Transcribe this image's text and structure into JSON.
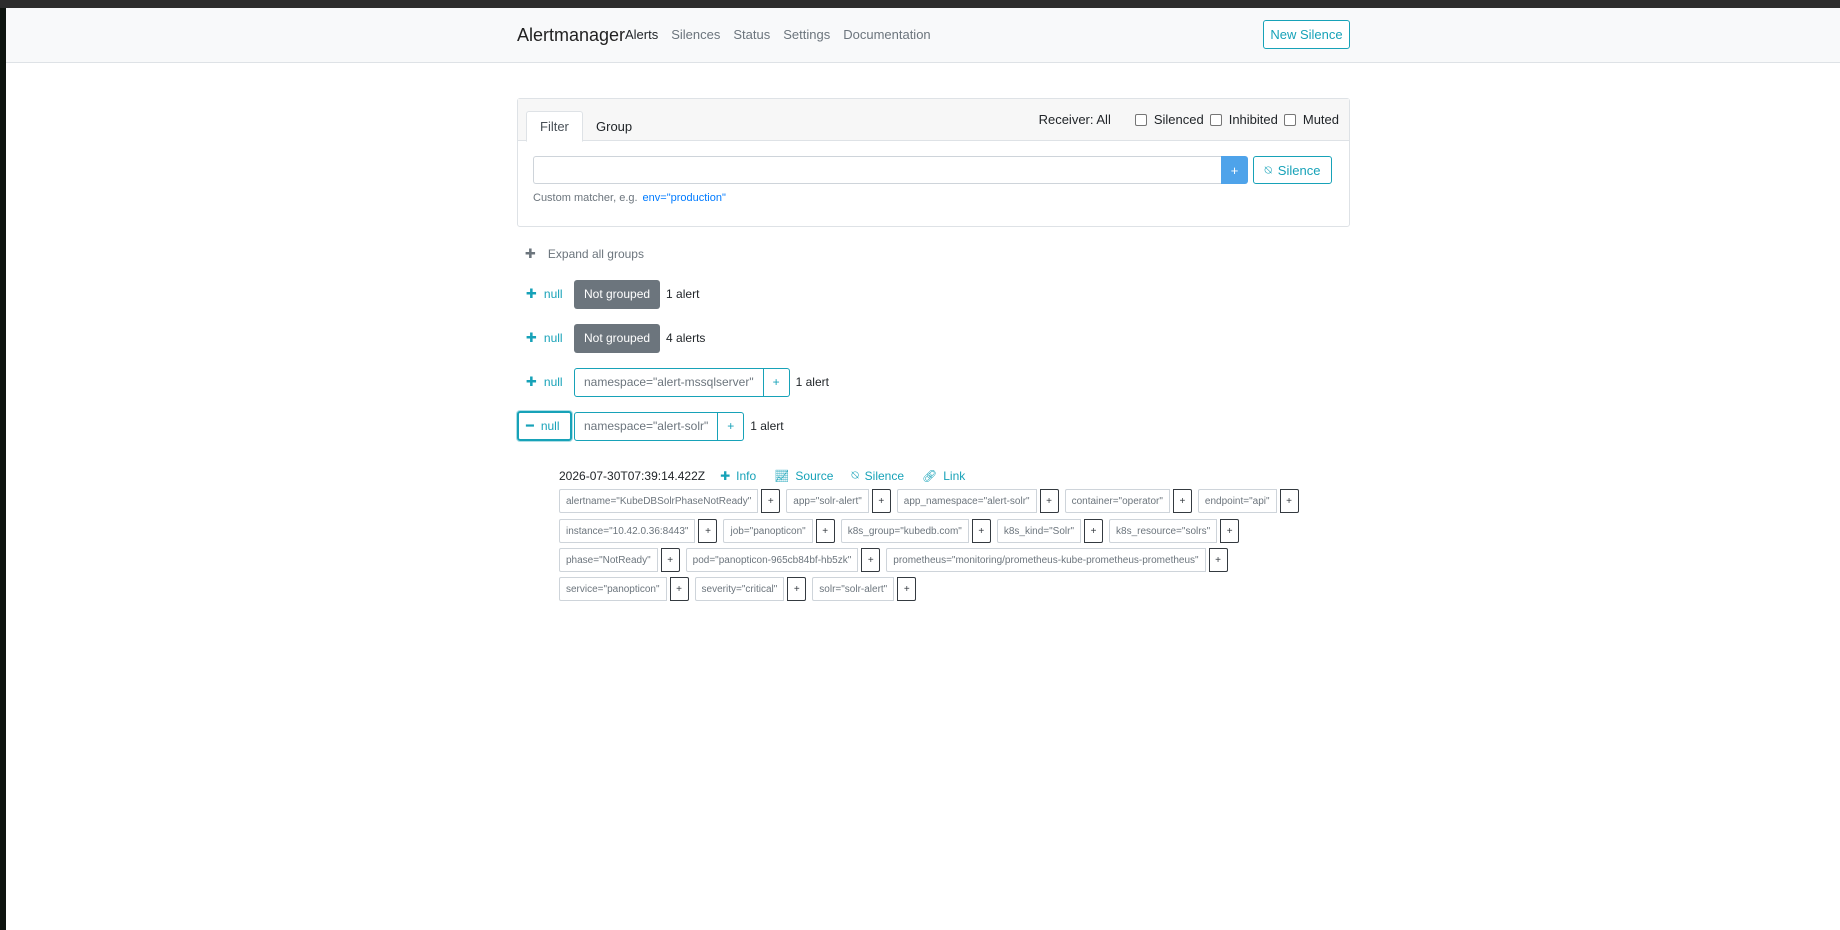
{
  "navbar": {
    "brand": "Alertmanager",
    "links": [
      "Alerts",
      "Silences",
      "Status",
      "Settings",
      "Documentation"
    ],
    "active": "Alerts",
    "new_silence": "New Silence"
  },
  "filter": {
    "tabs": [
      "Filter",
      "Group"
    ],
    "receiver": "Receiver: All",
    "checkboxes": [
      "Silenced",
      "Inhibited",
      "Muted"
    ],
    "input_value": "",
    "plus": "+",
    "silence_button": "Silence",
    "hint": "Custom matcher, e.g.",
    "hint_example": "env=\"production\""
  },
  "groups": {
    "expand_all": "Expand all groups",
    "list": [
      {
        "toggle": "null",
        "label": "Not grouped",
        "count": "1 alert"
      },
      {
        "toggle": "null",
        "label": "Not grouped",
        "count": "4 alerts"
      },
      {
        "toggle": "null",
        "label": "namespace=\"alert-mssqlserver\"",
        "count": "1 alert"
      },
      {
        "toggle": "null",
        "label": "namespace=\"alert-solr\"",
        "count": "1 alert"
      }
    ]
  },
  "alert": {
    "timestamp": "2026-07-30T07:39:14.422Z",
    "actions": [
      "Info",
      "Source",
      "Silence",
      "Link"
    ],
    "labels": [
      [
        "alertname=\"KubeDBSolrPhaseNotReady\"",
        "app=\"solr-alert\"",
        "app_namespace=\"alert-solr\"",
        "container=\"operator\"",
        "endpoint=\"api\""
      ],
      [
        "instance=\"10.42.0.36:8443\"",
        "job=\"panopticon\"",
        "k8s_group=\"kubedb.com\"",
        "k8s_kind=\"Solr\"",
        "k8s_resource=\"solrs\""
      ],
      [
        "phase=\"NotReady\"",
        "pod=\"panopticon-965cb84bf-hb5zk\"",
        "prometheus=\"monitoring/prometheus-kube-prometheus-prometheus\""
      ],
      [
        "service=\"panopticon\"",
        "severity=\"critical\"",
        "solr=\"solr-alert\""
      ]
    ]
  }
}
